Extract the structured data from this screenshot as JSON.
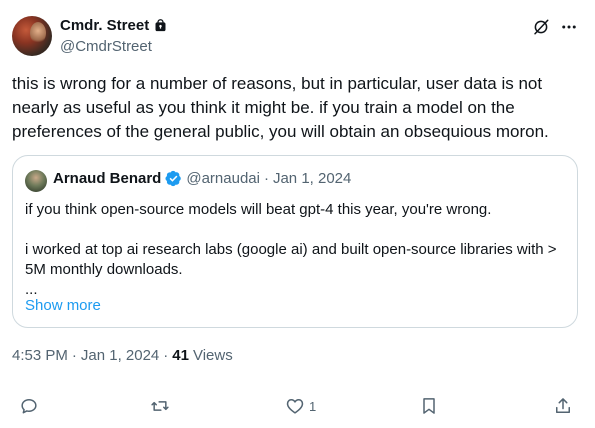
{
  "author": {
    "display_name": "Cmdr. Street",
    "handle": "@CmdrStreet",
    "protected": true
  },
  "tweet": {
    "text": "this is wrong for a number of reasons, but in particular, user data is not nearly as useful as you think it might be. if you train a model on the preferences of the general public, you will obtain an obsequious moron."
  },
  "quote": {
    "author_name": "Arnaud Benard",
    "verified": true,
    "handle": "@arnaudai",
    "separator": "·",
    "date": "Jan 1, 2024",
    "lines": [
      "if you think open-source models will beat gpt-4 this year, you're wrong.",
      "",
      "i worked at top ai research labs (google ai) and built open-source libraries with > 5M monthly downloads.",
      "..."
    ],
    "show_more_label": "Show more"
  },
  "meta": {
    "time": "4:53 PM",
    "separator1": "·",
    "date": "Jan 1, 2024",
    "separator2": "·",
    "views_count": "41",
    "views_label": "Views"
  },
  "actions": {
    "reply_count": "",
    "retweet_count": "",
    "like_count": "1",
    "bookmark_count": ""
  },
  "colors": {
    "accent": "#1d9bf0",
    "muted": "#536471",
    "text": "#0f1419",
    "border": "#cfd9de"
  },
  "icons": [
    "lock-icon",
    "grok-icon",
    "more-icon",
    "verified-icon",
    "reply-icon",
    "retweet-icon",
    "like-icon",
    "bookmark-icon",
    "share-icon"
  ]
}
